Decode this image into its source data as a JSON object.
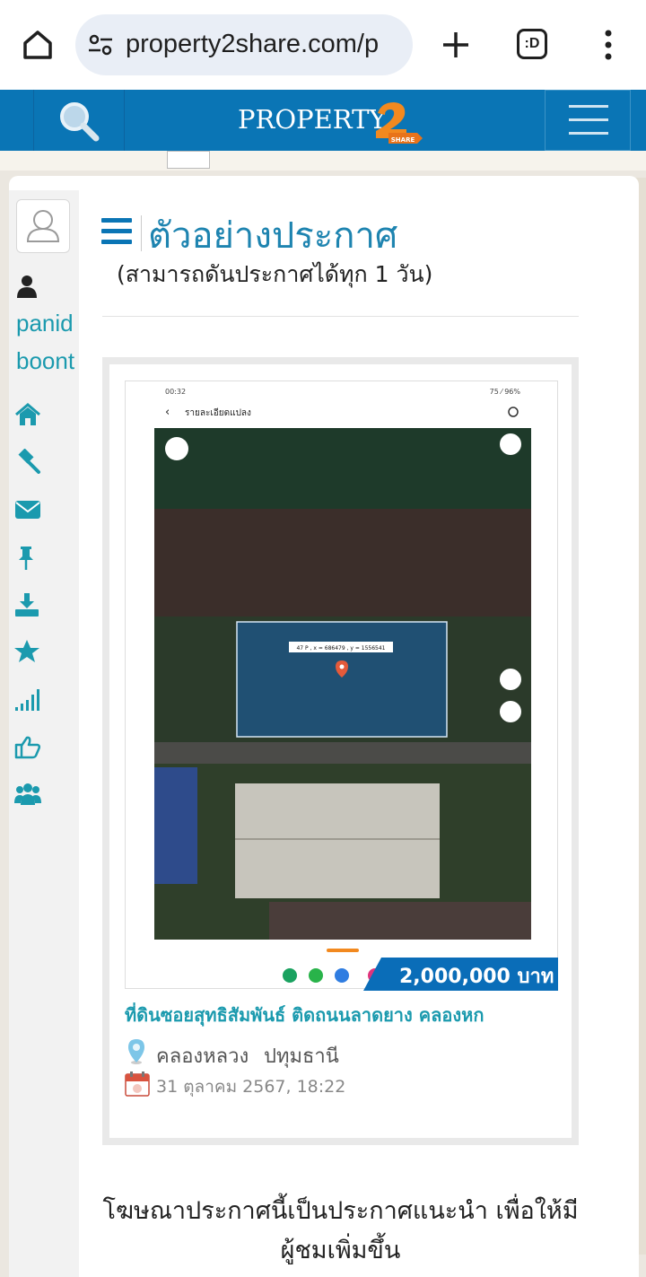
{
  "browser": {
    "url": "property2share.com/p",
    "tab_count_label": ":D",
    "icons": [
      "home-icon",
      "site-settings-icon",
      "plus-icon",
      "tabs-icon",
      "more-vert-icon"
    ]
  },
  "site_header": {
    "logo_text": "PROPERTY",
    "logo_badge": "SHARE",
    "brand_color": "#0a75b5"
  },
  "sidebar": {
    "user_name_line1": "panid",
    "user_name_line2": "boont",
    "icons": [
      "home-icon",
      "gavel-icon",
      "envelope-icon",
      "pin-icon",
      "download-icon",
      "star-icon",
      "signal-icon",
      "thumbs-up-icon",
      "users-icon"
    ]
  },
  "main": {
    "title": "ตัวอย่างประกาศ",
    "subtitle": "(สามารถดันประกาศได้ทุก  1 วัน)"
  },
  "listing": {
    "price": "2,000,000 บาท",
    "title": "ที่ดินซอยสุทธิสัมพันธ์ ติดถนนลาดยาง คลองหก",
    "district": "คลองหลวง",
    "province": "ปทุมธานี",
    "date": "31 ตุลาคม 2567, 18:22",
    "screenshot": {
      "status_time": "00:32",
      "status_right": "75 ⁄ 96%",
      "header_title": "รายละเอียดแปลง",
      "coord_label": "47 P , x = 686479 , y = 1556541"
    }
  },
  "footer_note": "โฆษณาประกาศนี้เป็นประกาศแนะนำ เพื่อให้มีผู้ชมเพิ่มขึ้น"
}
